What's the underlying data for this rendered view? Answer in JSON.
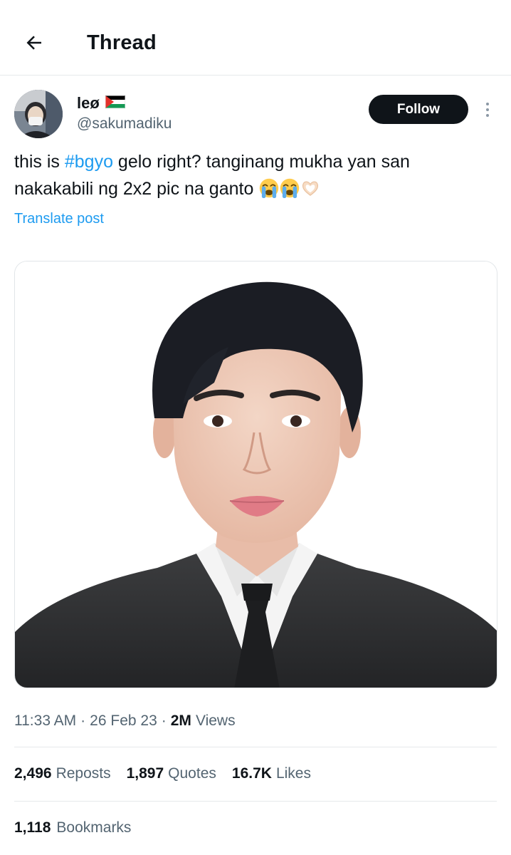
{
  "header": {
    "title": "Thread",
    "back_icon": "arrow-left-icon"
  },
  "author": {
    "name": "leø",
    "flag_icon": "palestine-flag-icon",
    "handle": "@sakumadiku",
    "follow_label": "Follow",
    "more_icon": "more-vertical-icon"
  },
  "post": {
    "text_before": "this is ",
    "hashtag": "#bgyo",
    "text_after": " gelo right? tanginang mukha yan san nakakabili ng 2x2 pic na ganto ",
    "emojis": [
      "loudly-crying-face-icon",
      "loudly-crying-face-icon",
      "heart-hands-icon"
    ],
    "translate_label": "Translate post"
  },
  "media": {
    "image_icon": "portrait-photo-icon"
  },
  "meta": {
    "time": "11:33 AM",
    "separator": "·",
    "date": "26 Feb 23",
    "views_count": "2M",
    "views_label": "Views"
  },
  "stats": {
    "reposts_count": "2,496",
    "reposts_label": "Reposts",
    "quotes_count": "1,897",
    "quotes_label": "Quotes",
    "likes_count": "16.7K",
    "likes_label": "Likes",
    "bookmarks_count": "1,118",
    "bookmarks_label": "Bookmarks"
  },
  "colors": {
    "accent": "#1d9bf0",
    "text_primary": "#0f1419",
    "text_secondary": "#536471",
    "divider": "#e6e9eb",
    "follow_bg": "#0f1419"
  }
}
